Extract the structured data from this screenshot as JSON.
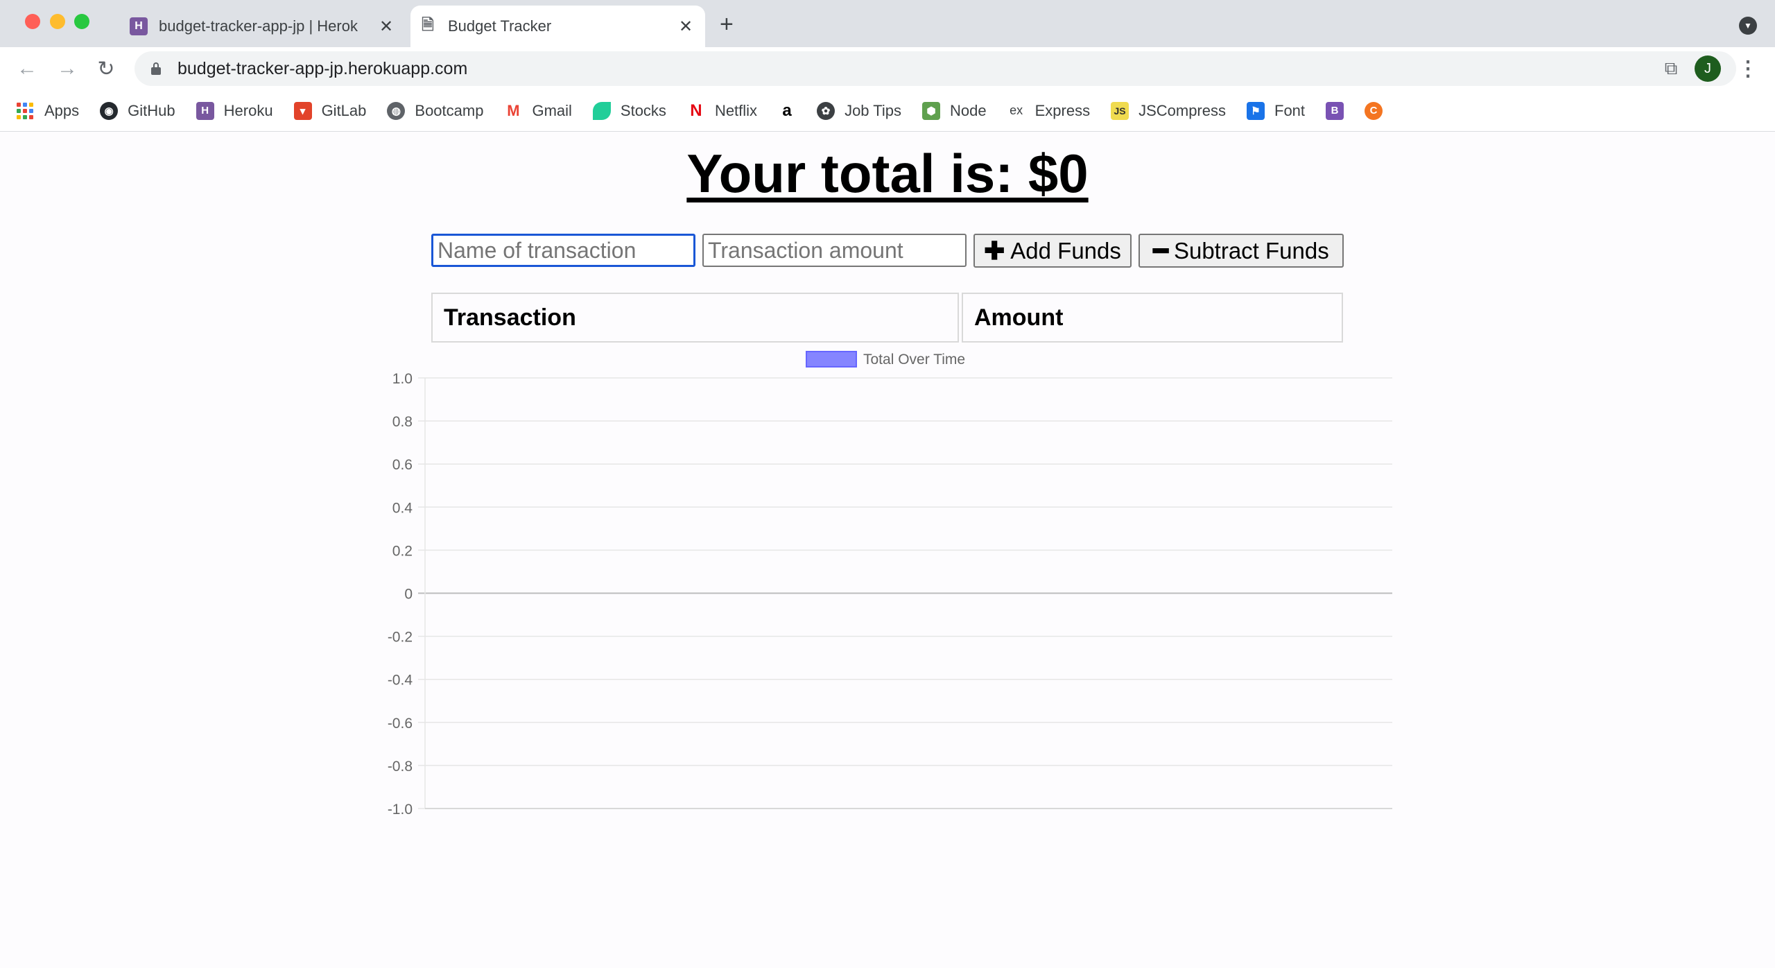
{
  "browser": {
    "tabs": [
      {
        "title": "budget-tracker-app-jp | Herok",
        "icon": "heroku-icon",
        "active": false
      },
      {
        "title": "Budget Tracker",
        "icon": "document-icon",
        "active": true
      }
    ],
    "url": "budget-tracker-app-jp.herokuapp.com",
    "avatar_initial": "J",
    "bookmarks": [
      {
        "label": "Apps",
        "icon": "apps-grid-icon"
      },
      {
        "label": "GitHub",
        "icon": "github-icon",
        "color": "#24292e"
      },
      {
        "label": "Heroku",
        "icon": "heroku-icon",
        "color": "#79589f"
      },
      {
        "label": "GitLab",
        "icon": "gitlab-icon",
        "color": "#e2432a"
      },
      {
        "label": "Bootcamp",
        "icon": "globe-icon",
        "color": "#5f6368"
      },
      {
        "label": "Gmail",
        "icon": "gmail-icon",
        "color": "#ea4335"
      },
      {
        "label": "Stocks",
        "icon": "leaf-icon",
        "color": "#21ce99"
      },
      {
        "label": "Netflix",
        "icon": "netflix-icon",
        "color": "#e50914"
      },
      {
        "label": "",
        "icon": "amazon-icon",
        "color": "#000000"
      },
      {
        "label": "Job Tips",
        "icon": "job-tips-icon",
        "color": "#3c4043"
      },
      {
        "label": "Node",
        "icon": "node-icon",
        "color": "#5fa04e"
      },
      {
        "label": "Express",
        "icon": "express-icon",
        "color": "#3c4043"
      },
      {
        "label": "JSCompress",
        "icon": "js-icon",
        "color": "#f0db4f"
      },
      {
        "label": "Font",
        "icon": "flag-icon",
        "color": "#1a73e8"
      },
      {
        "label": "",
        "icon": "bootstrap-icon",
        "color": "#7952b3"
      },
      {
        "label": "",
        "icon": "crunchyroll-icon",
        "color": "#f47521"
      }
    ]
  },
  "app": {
    "total_heading": "Your total is: $0",
    "name_placeholder": "Name of transaction",
    "amount_placeholder": "Transaction amount",
    "add_label": "Add Funds",
    "subtract_label": "Subtract Funds",
    "table_headers": [
      "Transaction",
      "Amount"
    ]
  },
  "chart_data": {
    "type": "line",
    "legend": [
      "Total Over Time"
    ],
    "series": [
      {
        "name": "Total Over Time",
        "values": [],
        "color": "#6666ff"
      }
    ],
    "categories": [],
    "ylim": [
      -1.0,
      1.0
    ],
    "yticks": [
      "1.0",
      "0.8",
      "0.6",
      "0.4",
      "0.2",
      "0",
      "-0.2",
      "-0.4",
      "-0.6",
      "-0.8",
      "-1.0"
    ],
    "grid": true,
    "legend_position": "top-center"
  }
}
